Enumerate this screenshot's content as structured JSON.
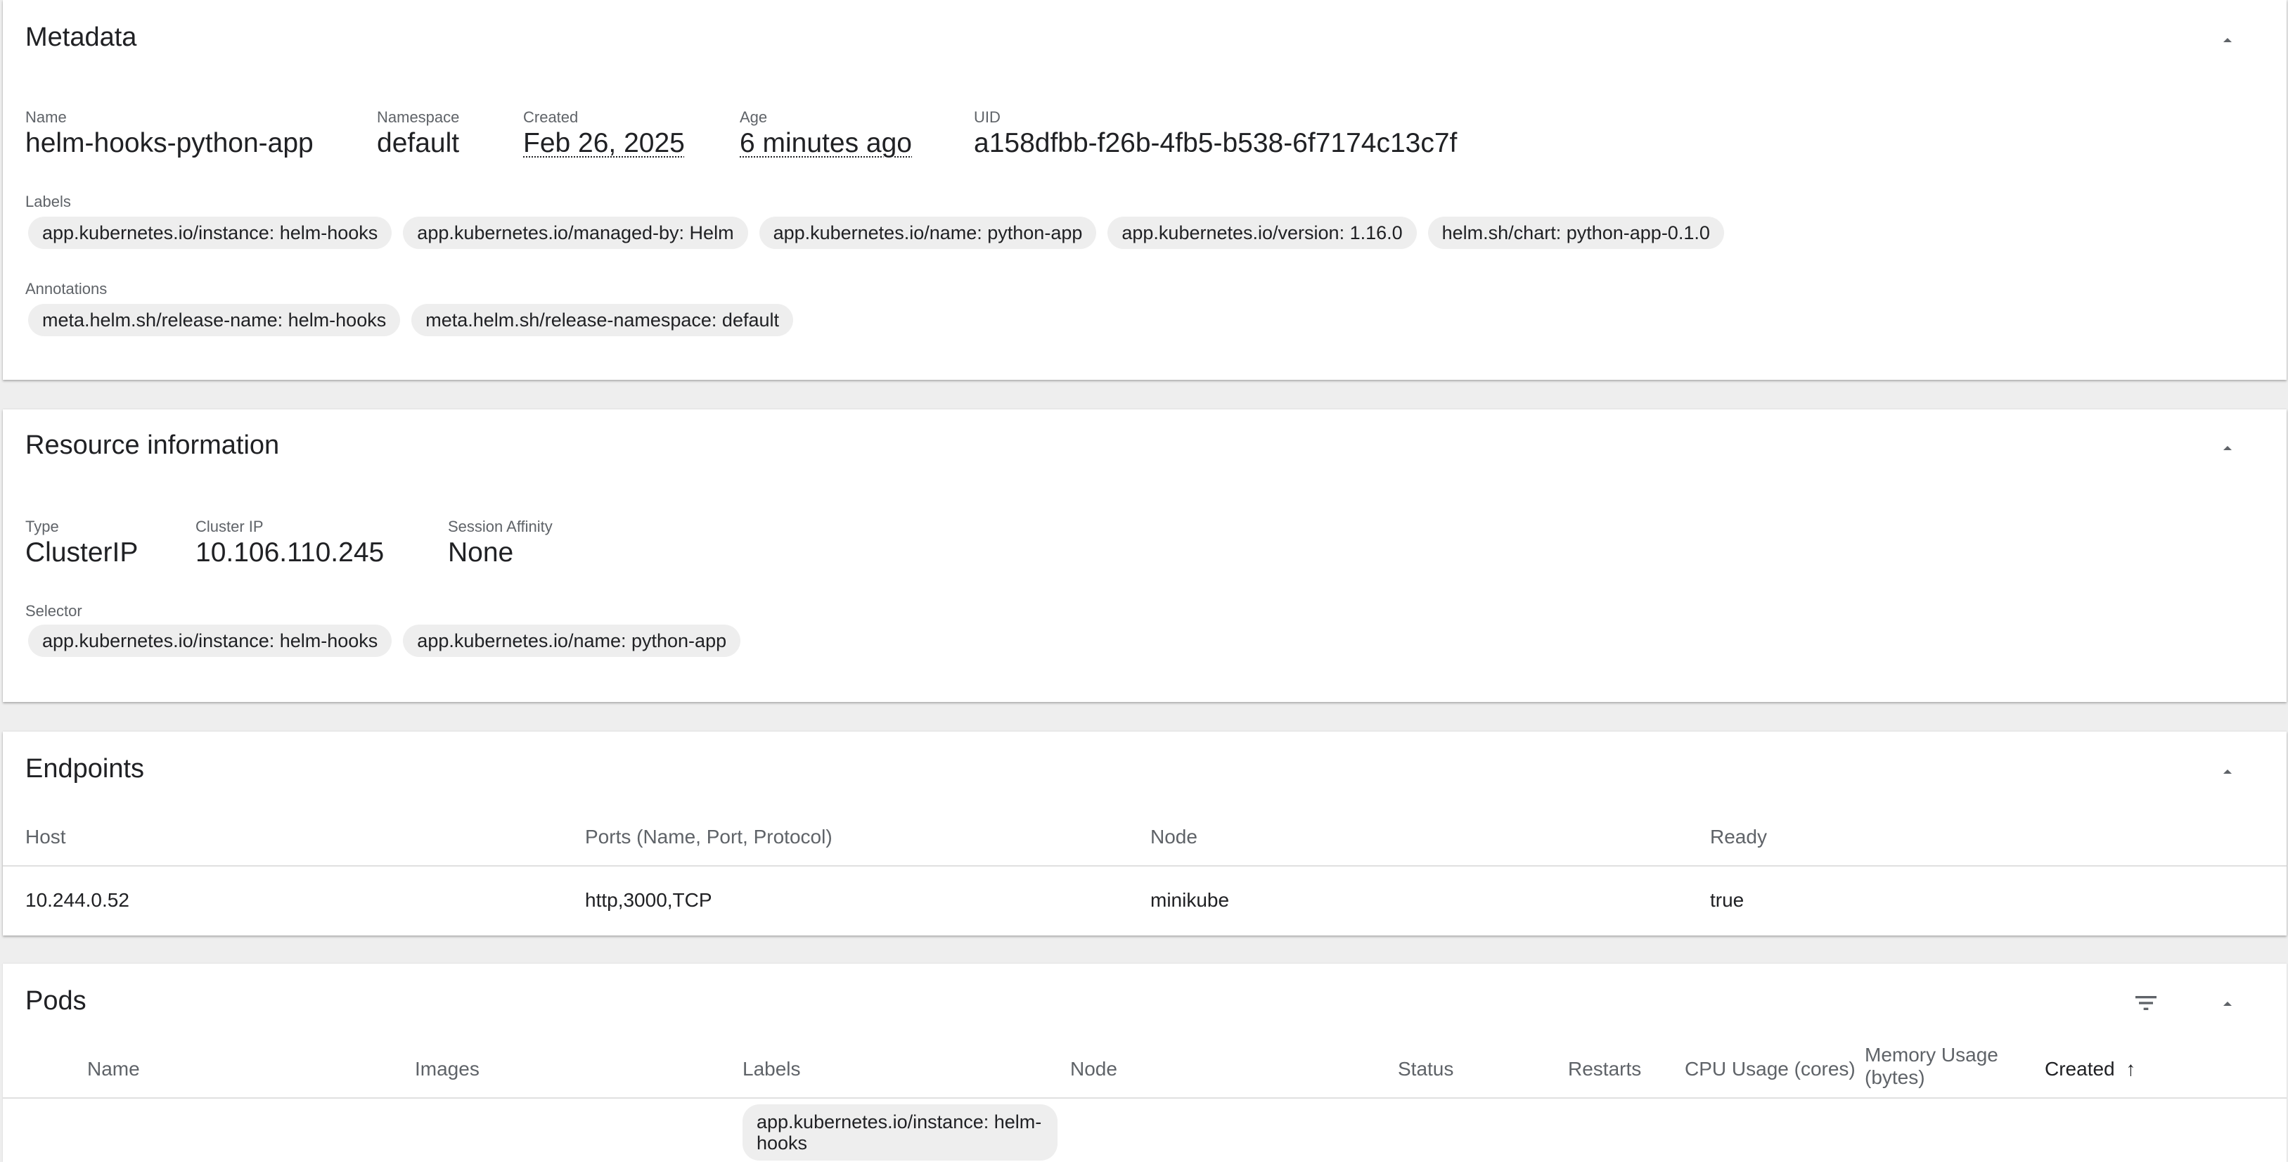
{
  "metadata": {
    "title": "Metadata",
    "fields": [
      {
        "label": "Name",
        "value": "helm-hooks-python-app"
      },
      {
        "label": "Namespace",
        "value": "default"
      },
      {
        "label": "Created",
        "value": "Feb 26, 2025"
      },
      {
        "label": "Age",
        "value": "6 minutes ago"
      },
      {
        "label": "UID",
        "value": "a158dfbb-f26b-4fb5-b538-6f7174c13c7f"
      }
    ],
    "labels_title": "Labels",
    "labels": [
      "app.kubernetes.io/instance: helm-hooks",
      "app.kubernetes.io/managed-by: Helm",
      "app.kubernetes.io/name: python-app",
      "app.kubernetes.io/version: 1.16.0",
      "helm.sh/chart: python-app-0.1.0"
    ],
    "annotations_title": "Annotations",
    "annotations": [
      "meta.helm.sh/release-name: helm-hooks",
      "meta.helm.sh/release-namespace: default"
    ]
  },
  "resource": {
    "title": "Resource information",
    "fields": [
      {
        "label": "Type",
        "value": "ClusterIP"
      },
      {
        "label": "Cluster IP",
        "value": "10.106.110.245"
      },
      {
        "label": "Session Affinity",
        "value": "None"
      }
    ],
    "selector_title": "Selector",
    "selector": [
      "app.kubernetes.io/instance: helm-hooks",
      "app.kubernetes.io/name: python-app"
    ]
  },
  "endpoints": {
    "title": "Endpoints",
    "columns": [
      "Host",
      "Ports (Name, Port, Protocol)",
      "Node",
      "Ready"
    ],
    "rows": [
      [
        "10.244.0.52",
        "http,3000,TCP",
        "minikube",
        "true"
      ]
    ]
  },
  "pods": {
    "title": "Pods",
    "columns": [
      "Name",
      "Images",
      "Labels",
      "Node",
      "Status",
      "Restarts",
      "CPU Usage (cores)",
      "Memory Usage (bytes)",
      "Created"
    ],
    "memory_col": {
      "line1": "Memory Usage",
      "line2": "(bytes)"
    },
    "sort_indicator": "↑",
    "first_row_label": "app.kubernetes.io/instance: helm-hooks"
  },
  "icons": {
    "collapse": "expand-less-icon",
    "filter": "filter-list-icon",
    "sort": "arrow-upward-icon"
  }
}
